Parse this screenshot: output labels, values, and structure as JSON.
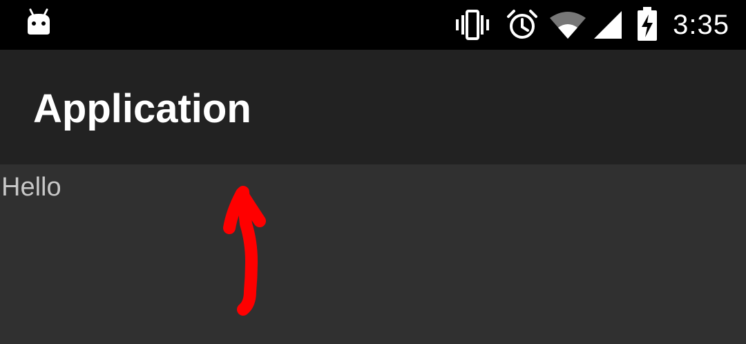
{
  "status_bar": {
    "time": "3:35",
    "left_icon": "android-notification-icon",
    "right_icons": [
      "vibrate-icon",
      "alarm-icon",
      "wifi-icon",
      "cell-signal-icon",
      "battery-charging-icon"
    ]
  },
  "app_bar": {
    "title": "Application"
  },
  "content": {
    "text": "Hello"
  },
  "colors": {
    "status_bar_bg": "#000000",
    "app_bar_bg": "#222222",
    "content_bg": "#303030",
    "annotation": "#ff0000"
  }
}
